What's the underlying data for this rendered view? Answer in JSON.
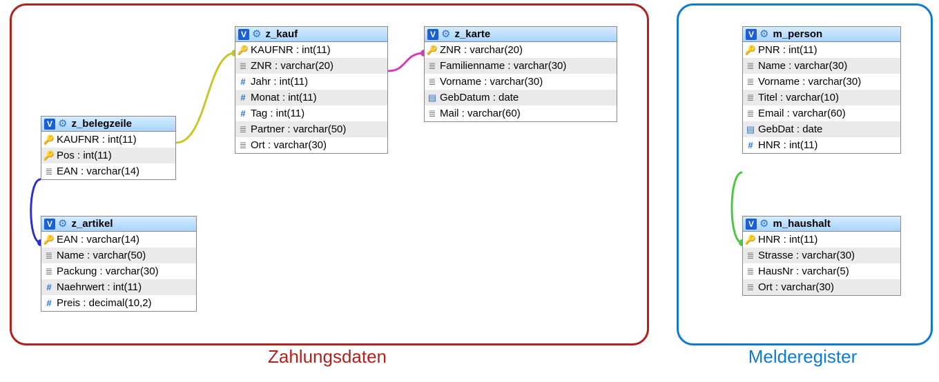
{
  "groups": {
    "zahlungsdaten": {
      "label": "Zahlungsdaten",
      "color": "#b0221f"
    },
    "melderegister": {
      "label": "Melderegister",
      "color": "#0e7bd0"
    }
  },
  "badge": "V",
  "tables": {
    "z_belegzeile": {
      "title": "z_belegzeile",
      "cols": [
        {
          "icon": "key",
          "label": "KAUFNR : int(11)"
        },
        {
          "icon": "key",
          "label": "Pos : int(11)"
        },
        {
          "icon": "text",
          "label": "EAN : varchar(14)"
        }
      ]
    },
    "z_artikel": {
      "title": "z_artikel",
      "cols": [
        {
          "icon": "key",
          "label": "EAN : varchar(14)"
        },
        {
          "icon": "text",
          "label": "Name : varchar(50)"
        },
        {
          "icon": "text",
          "label": "Packung : varchar(30)"
        },
        {
          "icon": "hash",
          "label": "Naehrwert : int(11)"
        },
        {
          "icon": "hash",
          "label": "Preis : decimal(10,2)"
        }
      ]
    },
    "z_kauf": {
      "title": "z_kauf",
      "cols": [
        {
          "icon": "key",
          "label": "KAUFNR : int(11)"
        },
        {
          "icon": "text",
          "label": "ZNR : varchar(20)"
        },
        {
          "icon": "hash",
          "label": "Jahr : int(11)"
        },
        {
          "icon": "hash",
          "label": "Monat : int(11)"
        },
        {
          "icon": "hash",
          "label": "Tag : int(11)"
        },
        {
          "icon": "text",
          "label": "Partner : varchar(50)"
        },
        {
          "icon": "text",
          "label": "Ort : varchar(30)"
        }
      ]
    },
    "z_karte": {
      "title": "z_karte",
      "cols": [
        {
          "icon": "key",
          "label": "ZNR : varchar(20)"
        },
        {
          "icon": "text",
          "label": "Familienname : varchar(30)"
        },
        {
          "icon": "text",
          "label": "Vorname : varchar(30)"
        },
        {
          "icon": "date",
          "label": "GebDatum : date"
        },
        {
          "icon": "text",
          "label": "Mail : varchar(60)"
        }
      ]
    },
    "m_person": {
      "title": "m_person",
      "cols": [
        {
          "icon": "key",
          "label": "PNR : int(11)"
        },
        {
          "icon": "text",
          "label": "Name : varchar(30)"
        },
        {
          "icon": "text",
          "label": "Vorname : varchar(30)"
        },
        {
          "icon": "text",
          "label": "Titel : varchar(10)"
        },
        {
          "icon": "text",
          "label": "Email : varchar(60)"
        },
        {
          "icon": "date",
          "label": "GebDat : date"
        },
        {
          "icon": "hash",
          "label": "HNR : int(11)"
        }
      ]
    },
    "m_haushalt": {
      "title": "m_haushalt",
      "cols": [
        {
          "icon": "key",
          "label": "HNR : int(11)"
        },
        {
          "icon": "text",
          "label": "Strasse : varchar(30)"
        },
        {
          "icon": "text",
          "label": "HausNr : varchar(5)"
        },
        {
          "icon": "text",
          "label": "Ort : varchar(30)"
        }
      ]
    }
  },
  "connectors": {
    "yellow": "#c8c62a",
    "magenta": "#d63ab8",
    "blue": "#2d2ecd",
    "green": "#4ec544"
  }
}
